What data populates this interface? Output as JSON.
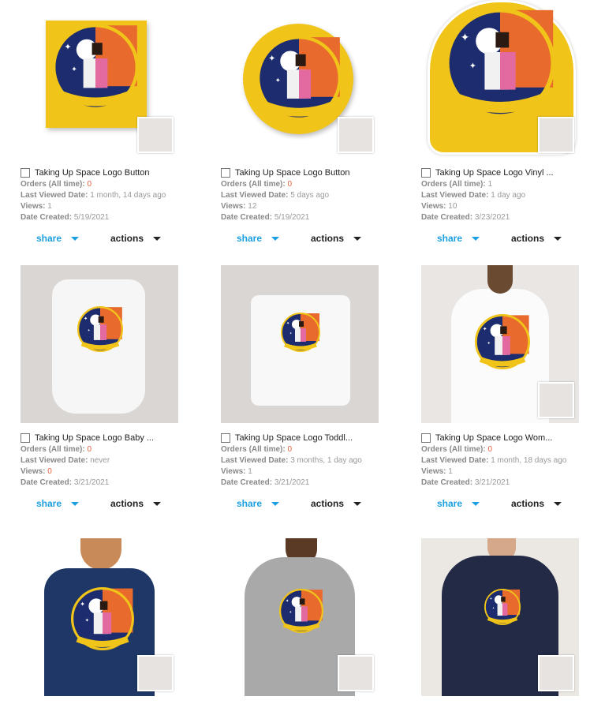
{
  "products": [
    {
      "title": "Taking Up Space Logo Button",
      "orders": "0",
      "last_viewed": "1 month, 14 days ago",
      "views": "1",
      "created": "5/19/2021"
    },
    {
      "title": "Taking Up Space Logo Button",
      "orders": "0",
      "last_viewed": "5 days ago",
      "views": "12",
      "created": "5/19/2021"
    },
    {
      "title": "Taking Up Space Logo Vinyl ...",
      "orders": "1",
      "last_viewed": "1 day ago",
      "views": "10",
      "created": "3/23/2021"
    },
    {
      "title": "Taking Up Space Logo Baby ...",
      "orders": "0",
      "last_viewed": "never",
      "views": "0",
      "created": "3/21/2021"
    },
    {
      "title": "Taking Up Space Logo Toddl...",
      "orders": "0",
      "last_viewed": "3 months, 1 day ago",
      "views": "1",
      "created": "3/21/2021"
    },
    {
      "title": "Taking Up Space Logo Wom...",
      "orders": "0",
      "last_viewed": "1 month, 18 days ago",
      "views": "1",
      "created": "3/21/2021"
    }
  ],
  "labels": {
    "orders": "Orders (All time): ",
    "last_viewed": "Last Viewed Date: ",
    "views": "Views: ",
    "created": "Date Created: ",
    "share": "share",
    "actions": "actions"
  },
  "logo_text": "TAKING UP SPACE",
  "icons": [
    "checkbox-icon",
    "share-dropdown-icon",
    "actions-dropdown-icon"
  ]
}
